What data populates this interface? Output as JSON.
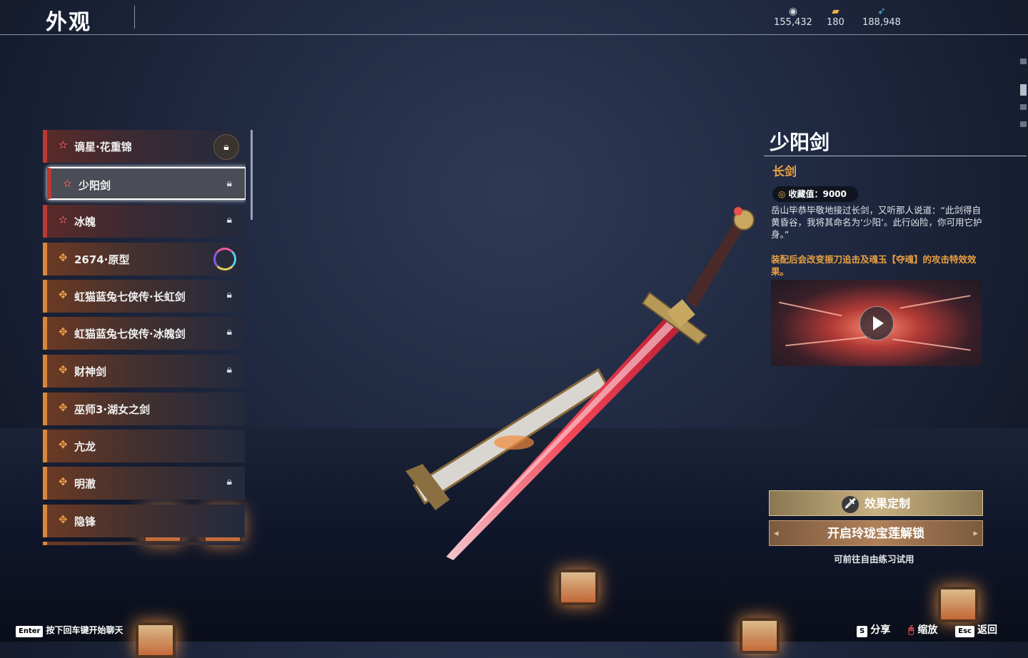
{
  "header": {
    "title": "外观",
    "currencies": [
      {
        "icon": "coin-icon",
        "value": "155,432"
      },
      {
        "icon": "ticket-icon",
        "value": "180"
      },
      {
        "icon": "feather-icon",
        "value": "188,948"
      }
    ]
  },
  "list": [
    {
      "label": "谪星·花重锦",
      "tier": "red",
      "state": "lock-badge"
    },
    {
      "label": "少阳剑",
      "tier": "red",
      "state": "lock",
      "selected": true
    },
    {
      "label": "冰魄",
      "tier": "red",
      "state": "lock"
    },
    {
      "label": "2674·原型",
      "tier": "orange",
      "state": "ring"
    },
    {
      "label": "虹猫蓝兔七侠传·长虹剑",
      "tier": "orange",
      "state": "lock"
    },
    {
      "label": "虹猫蓝兔七侠传·冰魄剑",
      "tier": "orange",
      "state": "lock"
    },
    {
      "label": "财神剑",
      "tier": "orange",
      "state": "lock"
    },
    {
      "label": "巫师3·湖女之剑",
      "tier": "orange",
      "state": "none"
    },
    {
      "label": "亢龙",
      "tier": "orange",
      "state": "none"
    },
    {
      "label": "明澈",
      "tier": "orange",
      "state": "lock"
    },
    {
      "label": "隐锋",
      "tier": "orange",
      "state": "none"
    }
  ],
  "detail": {
    "name": "少阳剑",
    "type": "长剑",
    "collection": "收藏值：9000",
    "description": "岳山毕恭毕敬地接过长剑，又听那人说道：“此剑得自黄昏谷，我将其命名为‘少阳’。此行凶险，你可用它护身。”",
    "effect": "装配后会改变振刀追击及魂玉【夺魂】的攻击特效效果。",
    "customize_label": "效果定制",
    "unlock_label": "开启玲珑宝莲解锁",
    "trial_label": "可前往自由练习试用"
  },
  "footer": {
    "chat_key": "Enter",
    "chat_hint": "按下回车键开始聊天",
    "share_key": "S",
    "share_label": "分享",
    "zoom_label": "缩放",
    "back_key": "Esc",
    "back_label": "返回"
  }
}
